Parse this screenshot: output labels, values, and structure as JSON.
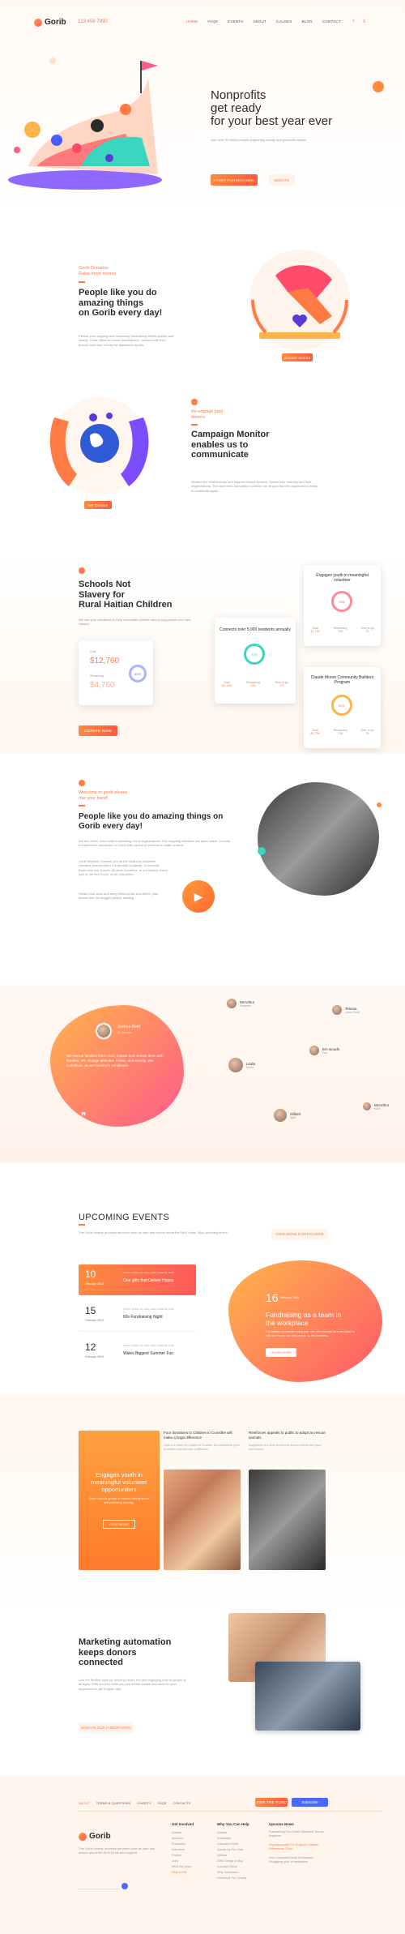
{
  "header": {
    "logo": "Gorib",
    "phone": "123 456 7890",
    "nav": [
      "HOME",
      "FAQS",
      "EVENTS",
      "ABOUT",
      "CAUSES",
      "BLOG",
      "CONTACT"
    ]
  },
  "hero": {
    "title_l1": "Nonprofits",
    "title_l2": "get ready",
    "title_l3": "for your best year ever",
    "text": "Join over 30 million people supporting charity and personal causes.",
    "btn_primary": "START FUNDRAISING",
    "btn_secondary": "DONATE"
  },
  "section1": {
    "subtitle_l1": "Gorib Donation",
    "subtitle_l2": "Raise more money",
    "title_l1": "People like you do",
    "title_l2": "amazing things",
    "title_l3": "on Gorib every day!",
    "text": "Please your ongoing and temporary fundraising efforts quickly and clearly. Gorib offers an online marketplace, connect with their donors and raise money for Alabama's sports.",
    "badge": "Donate Online"
  },
  "section2": {
    "subtitle_l1": "Re-engage past",
    "subtitle_l2": "donors",
    "title_l1": "Campaign Monitor",
    "title_l2": "enables us to",
    "title_l3": "communicate",
    "text": "Reward the relationships and support donors forward. Retain your monthly and their organizations. The confirmed foundation could be run at your favorite organization easily to contribute again.",
    "badge": "We Donate"
  },
  "schools": {
    "title_l1": "Schools Not",
    "title_l2": "Slavery for",
    "title_l3": "Rural Haitian Children",
    "text": "We use your donations to help vulnerable children and young people end their slavery.",
    "goal_label": "Goal",
    "goal_value": "$12,760",
    "raised_label": "Remaining",
    "raised_value": "$4,760",
    "ring_value": "85%",
    "btn": "DONATE NOW",
    "card1": {
      "title": "Connects over 5,000 residents annually",
      "ring": "72%",
      "l1": "Goal",
      "v1": "$1,750",
      "l2": "Remaining",
      "v2": "726",
      "l3": "Time to go",
      "v3": "76"
    },
    "card2": {
      "title": "Engages youth in meaningful volunteer",
      "ring": "75%",
      "l1": "Goal",
      "v1": "$1,750",
      "l2": "Remaining",
      "v2": "726",
      "l3": "Time to go",
      "v3": "76"
    },
    "card3": {
      "title": "Claude Moore Community Builders Program",
      "ring": "60%",
      "l1": "Goal",
      "v1": "$1,750",
      "l2": "Remaining",
      "v2": "726",
      "l3": "Time to go",
      "v3": "76"
    }
  },
  "welcome": {
    "subtitle_l1": "Welcome to gorib please",
    "subtitle_l2": "rise your hand!",
    "title_l1": "People like you do amazing things on",
    "title_l2": "Gorib every day!",
    "text1": "We are Gorib, how nonfit fundraising / fund organizations. Our outgoing websites are taken place, a social entrepreneur connection to Gorib with variety of services to make a strive.",
    "text2": "Gorib Monitor! Connect you as the kindness volunteer interface around when it is already a popular. It connects those who are donors. All other countries. In our history, every part of the free hours, at all volunteers.",
    "text3": "Relate your work and deep fellow pride and deliver your advice and the dogged people reading."
  },
  "testimonials": {
    "main_name": "Joshua Reid",
    "main_role": "Co-founder",
    "main_text": "We rescue families from crisis, impact and reunite them with families. We change attitudes, inside, and society. We contribute, as we transform conditions.",
    "people": [
      {
        "name": "McArthur",
        "role": "Volunteer"
      },
      {
        "name": "Tenesa",
        "role": "Loves Gorib"
      },
      {
        "name": "Linda",
        "role": "Donor"
      },
      {
        "name": "Em woods",
        "role": "Fan"
      },
      {
        "name": "Gilbert",
        "role": "Staff"
      },
      {
        "name": "McArthur",
        "role": "Host"
      }
    ]
  },
  "events": {
    "title": "UPCOMING EVENTS",
    "text": "The Gorib charity provides services such as care and advice about the NHS funds. Buy upcoming event.",
    "btn": "VIEW MORE EVENTS HERE",
    "list": [
      {
        "day": "10",
        "month": "February 2019",
        "meta": "START: APRIL 18, 2019   |   END: JUNE 05, 2019",
        "title": "One gifts that Deliver Happy"
      },
      {
        "day": "15",
        "month": "February 2019",
        "meta": "START: APRIL 18, 2019   |   END: JUNE 05, 2019",
        "title": "60s Fundraising Night"
      },
      {
        "day": "12",
        "month": "February 2019",
        "meta": "START: APRIL 18, 2019   |   END: JUNE 05, 2019",
        "title": "Wales Biggest Summer Fun"
      }
    ],
    "feature_day": "16",
    "feature_month": "February 2019",
    "feature_title_l1": "Fundraising as a team in",
    "feature_title_l2": "the workplace",
    "feature_text": "Our tableau of charities every year. We will celebrate for a new team to help our events and help people for the homeless.",
    "feature_btn": "LEARN MORE"
  },
  "causes": {
    "card1_title_l1": "Engages youth in",
    "card1_title_l2": "meaningful volunteer",
    "card1_title_l3": "opportunities",
    "card1_text": "Gorib supports groups of children leaving school and partnering learning.",
    "card1_btn": "READ MORE",
    "card2_title": "Four donations to Children in Crossfire will make a huge difference",
    "card2_text": "Gorib is a charity for Children in Crossfire. All contributions given to children fund will make a difference.",
    "card3_title": "Reinforces appeals to public to adopt as rescue animals",
    "card3_text": "Badgershire is a Gorib charity that rescues animals and gives them homes."
  },
  "marketing": {
    "title_l1": "Marketing automation",
    "title_l2": "keeps donors",
    "title_l3": "connected",
    "text": "Use the flexible tools for sending smart, fun and engaging mail to people of all ages. With our new tools you can create emails and send for your supporters to get to grips with.",
    "btn": "DONATE OUR FUNDRAISING"
  },
  "footer": {
    "links": [
      "ABOUT",
      "TERMS & QUESTIONS",
      "CHARITY",
      "FAQS",
      "CONTACTS"
    ],
    "btn1": "JOIN THE FUND",
    "btn2": "Subscribe",
    "logo": "Gorib",
    "about_text": "The Gorib charity provides services such as care and advice about the NHS funds and support.",
    "col1_title": "Get Involved",
    "col1": [
      "Donate",
      "Sponsor",
      "Fundraise",
      "Volunteer",
      "Partner",
      "Jobs",
      "Meet the team",
      "Give a Gift"
    ],
    "col2_title": "Why You Can Help",
    "col2": [
      "Donate",
      "Fundraise",
      "Volunteer Here!",
      "Speak Up For Kids",
      "Affiliate",
      "Gifts Things to Buy",
      "Summer Week",
      "Why Volunteers",
      "Facebook For Charity"
    ],
    "col3_title": "Upcome News",
    "col3": [
      "Fundraising Fun Event Weekend Tonner Angleton",
      "Now launched! For Support Children Differences Gorib",
      "Now Launched Book Kindness's Struggling year of resistance"
    ]
  }
}
